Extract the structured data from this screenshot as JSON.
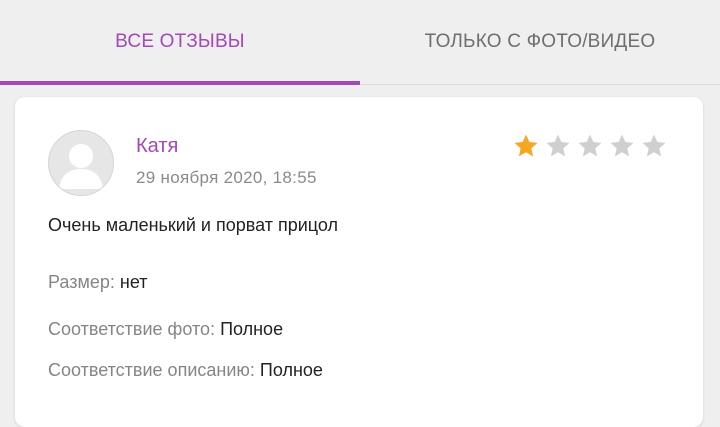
{
  "tabs": {
    "all_reviews": "ВСЕ ОТЗЫВЫ",
    "photo_video_only": "ТОЛЬКО С ФОТО/ВИДЕО",
    "active_color": "#a447b8"
  },
  "review": {
    "author": "Катя",
    "date": "29 ноября 2020, 18:55",
    "rating": 1,
    "rating_max": 5,
    "star_filled_color": "#f5a623",
    "star_empty_color": "#cfcfcf",
    "text": "Очень маленький и порват прицол",
    "avatar_icon": "default-user-avatar",
    "attributes": {
      "size_label": "Размер:",
      "size_value": "нет",
      "photo_match_label": "Соответствие фото:",
      "photo_match_value": "Полное",
      "description_match_label": "Соответствие описанию:",
      "description_match_value": "Полное"
    }
  }
}
